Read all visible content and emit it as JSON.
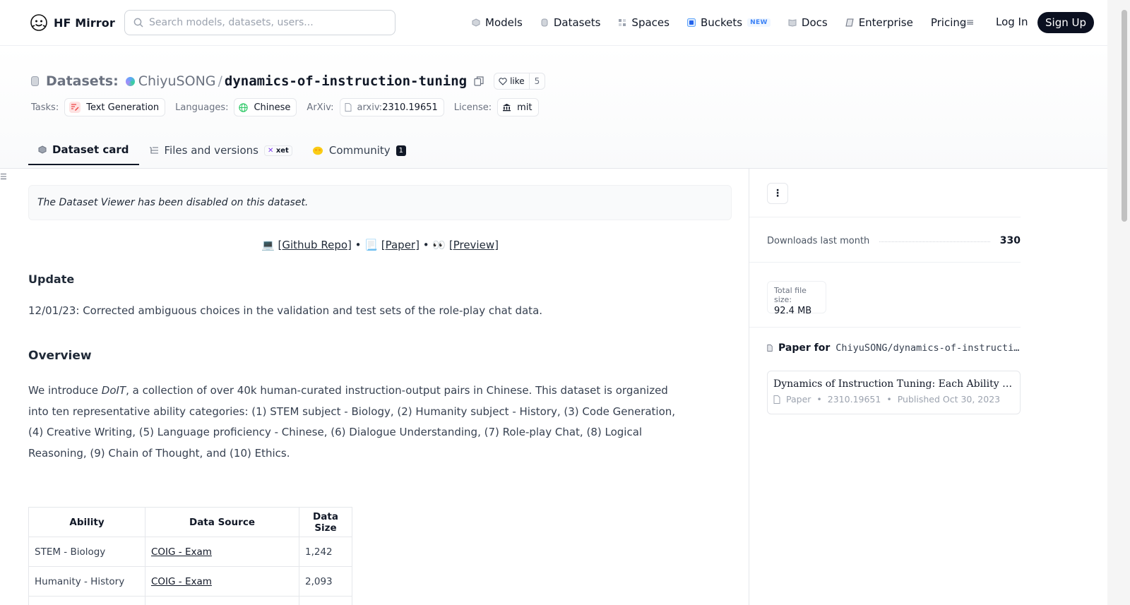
{
  "header": {
    "brand": "HF Mirror",
    "search_placeholder": "Search models, datasets, users...",
    "nav": [
      {
        "label": "Models",
        "icon": "cube-icon"
      },
      {
        "label": "Datasets",
        "icon": "database-icon"
      },
      {
        "label": "Spaces",
        "icon": "grid-icon"
      },
      {
        "label": "Buckets",
        "icon": "bucket-icon",
        "badge": "NEW"
      },
      {
        "label": "Docs",
        "icon": "book-icon"
      },
      {
        "label": "Enterprise",
        "icon": "enterprise-icon"
      },
      {
        "label": "Pricing"
      }
    ],
    "login": "Log In",
    "signup": "Sign Up"
  },
  "repo": {
    "section_label": "Datasets:",
    "owner": "ChiyuSONG",
    "name": "dynamics-of-instruction-tuning",
    "like_label": "like",
    "like_count": "5",
    "meta": {
      "tasks_label": "Tasks:",
      "task": "Text Generation",
      "languages_label": "Languages:",
      "language": "Chinese",
      "arxiv_label": "ArXiv:",
      "arxiv_prefix": "arxiv:",
      "arxiv_id": "2310.19651",
      "license_label": "License:",
      "license": "mit"
    },
    "tabs": [
      {
        "label": "Dataset card"
      },
      {
        "label": "Files and versions",
        "badge": "xet"
      },
      {
        "label": "Community",
        "count": "1"
      }
    ]
  },
  "main": {
    "notice": "The Dataset Viewer has been disabled on this dataset.",
    "links": {
      "github_emoji": "💻",
      "github": "[Github Repo]",
      "sep": "•",
      "paper_emoji": "📃",
      "paper": "[Paper]",
      "preview_emoji": "👀",
      "preview": "[Preview]"
    },
    "update_heading": "Update",
    "update_text": "12/01/23: Corrected ambiguous choices in the validation and test sets of the role-play chat data.",
    "overview_heading": "Overview",
    "overview_pre": "We introduce ",
    "overview_em": "DoIT",
    "overview_post": ", a collection of over 40k human-curated instruction-output pairs in Chinese. This dataset is organized into ten representative ability categories: (1) STEM subject - Biology, (2) Humanity subject - History, (3) Code Generation, (4) Creative Writing, (5) Language proficiency - Chinese, (6) Dialogue Understanding, (7) Role-play Chat, (8) Logical Reasoning, (9) Chain of Thought, and (10) Ethics.",
    "table": {
      "headers": [
        "Ability",
        "Data Source",
        "Data Size"
      ],
      "rows": [
        [
          "STEM - Biology",
          "COIG - Exam",
          "1,242"
        ],
        [
          "Humanity - History",
          "COIG - Exam",
          "2,093"
        ]
      ]
    }
  },
  "sidebar": {
    "downloads_label": "Downloads last month",
    "downloads_value": "330",
    "file_size_label": "Total file size:",
    "file_size_value": "92.4 MB",
    "paper_for_label": "Paper for",
    "paper_for_repo": "ChiyuSONG/dynamics-of-instruction-tuning",
    "paper_title": "Dynamics of Instruction Tuning: Each Ability of Large Language Models Has Its Own Growth Pace",
    "paper_type": "Paper",
    "paper_id": "2310.19651",
    "paper_published": "Published Oct 30, 2023",
    "dot": "•"
  }
}
